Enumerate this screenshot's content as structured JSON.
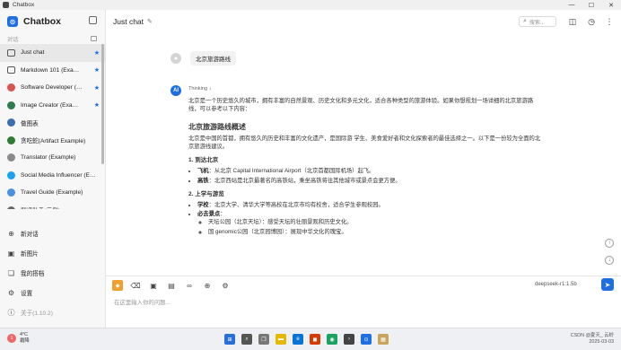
{
  "window": {
    "title": "Chatbox",
    "minimize": "—",
    "maximize": "☐",
    "close": "✕"
  },
  "sidebar": {
    "app_name": "Chatbox",
    "section_label": "对话",
    "items": [
      {
        "label": "Just chat",
        "starred": true,
        "avatar": "chat",
        "color": "#555555"
      },
      {
        "label": "Markdown 101 (Exa…",
        "starred": true,
        "avatar": "chat",
        "color": "#555555"
      },
      {
        "label": "Software Developer (…",
        "starred": true,
        "avatar": "img",
        "color": "#d9534f"
      },
      {
        "label": "Image Creator (Exa…",
        "starred": true,
        "avatar": "img",
        "color": "#2f7d4f"
      },
      {
        "label": "做图表",
        "starred": false,
        "avatar": "img",
        "color": "#3a6fb0"
      },
      {
        "label": "贪吃蛇(Artifact Example)",
        "starred": false,
        "avatar": "img",
        "color": "#2e7d32"
      },
      {
        "label": "Translator (Example)",
        "starred": false,
        "avatar": "img",
        "color": "#8a8a8a"
      },
      {
        "label": "Social Media Influencer (E…",
        "starred": false,
        "avatar": "img",
        "color": "#1da1f2"
      },
      {
        "label": "Travel Guide (Example)",
        "starred": false,
        "avatar": "img",
        "color": "#4a90e2"
      },
      {
        "label": "翻译助手(示例)",
        "starred": false,
        "avatar": "img",
        "color": "#666666"
      }
    ],
    "bottom": {
      "new_chat": "新对话",
      "new_image": "新图片",
      "my_partners": "我的搭档",
      "settings": "设置",
      "about": "关于(1.10.2)"
    }
  },
  "header": {
    "title": "Just chat",
    "search_placeholder": "搜索..."
  },
  "conversation": {
    "user_message": "北京旅游路线",
    "thinking_label": "Thinking",
    "intro": "北京是一个历史悠久的城市，拥有丰富的自然景观、历史文化和多元文化，适合各种类型的旅游体验。如果你想规划一场详细的北京旅游路线，可以参考以下内容：",
    "heading": "北京旅游路线概述",
    "overview": "北京是中国的首都，拥有悠久的历史和丰富的文化遗产，是国际游 学生、美食爱好者和文化探索者的最佳选择之一。以下是一份较为全面的北京旅游线建议。",
    "section1_title": "1. 到达北京",
    "s1_item1_label": "飞机",
    "s1_item1_text": "：从北京 Capital International Airport（北京首都国际机场）起飞。",
    "s1_item2_label": "高铁",
    "s1_item2_text": "：北京西站是北京最著名的高铁站，乘坐高铁将往其他城市或景点会更方便。",
    "section2_title": "2. 上学与游览",
    "s2_item1_label": "学校",
    "s2_item1_text": "：北京大学、清华大学等高校在北京市均有校舍，适合学生参观校园。",
    "s2_item2_label": "必去景点",
    "s2_item2_text": "：",
    "s2_sub1": "天坛公园（北京天坛）：感受天坛的壮丽景观和历史文化。",
    "s2_sub2": "国 genomic公园（北京园博园）：展现中华文化的瑰宝。"
  },
  "input": {
    "placeholder": "在这里输入你的问题...",
    "model": "deepseek-r1:1.5b"
  },
  "taskbar": {
    "temperature": "4°C",
    "weather": "霜降",
    "weather_badge": "1",
    "time": "CSDN @夏天_ 云岭",
    "date": "2025-03-03"
  }
}
